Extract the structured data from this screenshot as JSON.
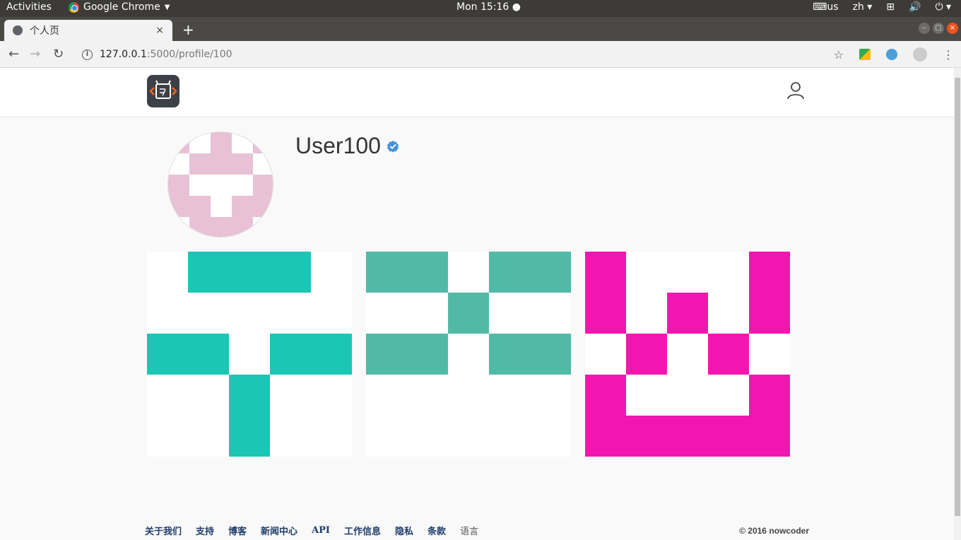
{
  "os": {
    "activities": "Activities",
    "app_name": "Google Chrome",
    "clock": "Mon 15:16 ●",
    "keyboard": "us",
    "language": "zh"
  },
  "browser": {
    "tab_title": "个人页",
    "tab_close": "×",
    "new_tab": "+",
    "url_host": "127.0.0.1",
    "url_path": ":5000/profile/100"
  },
  "site": {
    "username": "User100",
    "avatar_color": "#e8c1d6",
    "tiles": [
      {
        "color": "#1bc6b4"
      },
      {
        "color": "#51baa6"
      },
      {
        "color": "#f216b0"
      }
    ]
  },
  "footer": {
    "links": [
      "关于我们",
      "支持",
      "博客",
      "新闻中心",
      "API",
      "工作信息",
      "隐私",
      "条款"
    ],
    "language": "语言",
    "copyright": "© 2016 nowcoder"
  }
}
